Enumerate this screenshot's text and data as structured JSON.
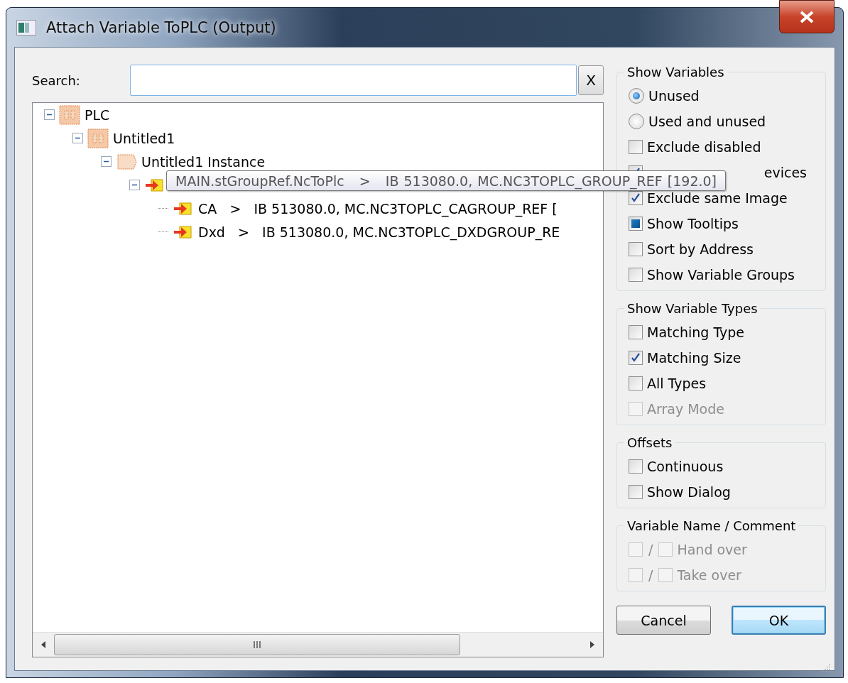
{
  "window": {
    "title": "Attach Variable ToPLC (Output)"
  },
  "search": {
    "label": "Search:",
    "clear": "X"
  },
  "tree": [
    {
      "kind": "folder",
      "label": "PLC",
      "expanded": true,
      "children": [
        {
          "kind": "folder",
          "label": "Untitled1",
          "expanded": true,
          "children": [
            {
              "kind": "instance",
              "label": "Untitled1 Instance",
              "expanded": true,
              "children": [
                {
                  "kind": "variable",
                  "expanded": true,
                  "children": [
                    {
                      "kind": "variable",
                      "label": "CA   >   IB 513080.0, MC.NC3TOPLC_CAGROUP_REF ["
                    },
                    {
                      "kind": "variable",
                      "label": "Dxd   >   IB 513080.0, MC.NC3TOPLC_DXDGROUP_RE"
                    }
                  ]
                }
              ]
            }
          ]
        }
      ]
    }
  ],
  "tooltip": "MAIN.stGroupRef.NcToPlc   >   IB 513080.0, MC.NC3TOPLC_GROUP_REF [192.0]",
  "groups": [
    {
      "title": "Show Variables",
      "items": [
        {
          "kind": "radio",
          "label": "Unused",
          "selected": true,
          "disabled": false
        },
        {
          "kind": "radio",
          "label": "Used and unused",
          "selected": false,
          "disabled": false
        },
        {
          "kind": "checkbox",
          "label": "Exclude disabled",
          "checked": false,
          "indeterminate": false,
          "disabled": false
        },
        {
          "kind": "covered_checkbox",
          "label": "evices",
          "checked": true,
          "indeterminate": false,
          "disabled": false
        },
        {
          "kind": "checkbox",
          "label": "Exclude same Image",
          "checked": true,
          "indeterminate": false,
          "disabled": false
        },
        {
          "kind": "checkbox",
          "label": "Show Tooltips",
          "checked": false,
          "indeterminate": true,
          "disabled": false
        },
        {
          "kind": "checkbox",
          "label": "Sort by Address",
          "checked": false,
          "indeterminate": false,
          "disabled": false
        },
        {
          "kind": "checkbox",
          "label": "Show Variable Groups",
          "checked": false,
          "indeterminate": false,
          "disabled": false
        }
      ]
    },
    {
      "title": "Show Variable Types",
      "items": [
        {
          "kind": "checkbox",
          "label": "Matching Type",
          "checked": false,
          "indeterminate": false,
          "disabled": false
        },
        {
          "kind": "checkbox",
          "label": "Matching Size",
          "checked": true,
          "indeterminate": false,
          "disabled": false
        },
        {
          "kind": "checkbox",
          "label": "All Types",
          "checked": false,
          "indeterminate": false,
          "disabled": false
        },
        {
          "kind": "checkbox",
          "label": "Array Mode",
          "checked": false,
          "indeterminate": false,
          "disabled": true
        }
      ]
    },
    {
      "title": "Offsets",
      "items": [
        {
          "kind": "checkbox",
          "label": "Continuous",
          "checked": false,
          "indeterminate": false,
          "disabled": false
        },
        {
          "kind": "checkbox",
          "label": "Show Dialog",
          "checked": false,
          "indeterminate": false,
          "disabled": false
        }
      ]
    },
    {
      "title": "Variable Name / Comment",
      "items": [
        {
          "kind": "pair",
          "label": "Hand over",
          "separator": "/",
          "checked": false,
          "checked_2": false,
          "disabled": true
        },
        {
          "kind": "pair",
          "label": "Take over",
          "separator": "/",
          "checked": false,
          "checked_2": false,
          "disabled": true
        }
      ]
    }
  ],
  "buttons": [
    {
      "label": "Cancel",
      "default": false
    },
    {
      "label": "OK",
      "default": true
    }
  ]
}
